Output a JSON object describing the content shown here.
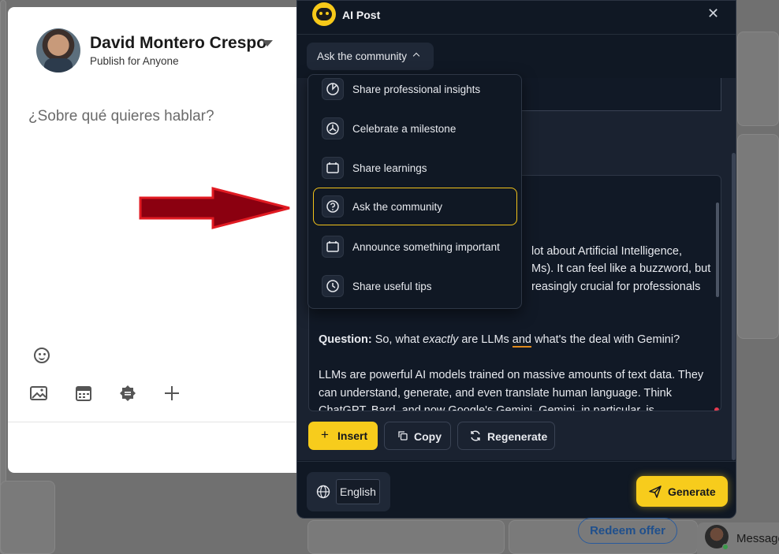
{
  "composer": {
    "user_name": "David Montero Crespo",
    "audience": "Publish for Anyone",
    "placeholder": "¿Sobre qué quieres hablar?"
  },
  "ai_panel": {
    "title": "AI Post",
    "tone_button": "Ask the community",
    "dropdown_items": [
      {
        "label": "Share professional insights",
        "icon": "pie-chart-icon"
      },
      {
        "label": "Celebrate a milestone",
        "icon": "milestone-icon"
      },
      {
        "label": "Share learnings",
        "icon": "learnings-icon"
      },
      {
        "label": "Ask the community",
        "icon": "question-icon",
        "selected": true
      },
      {
        "label": "Announce something important",
        "icon": "calendar-icon"
      },
      {
        "label": "Share useful tips",
        "icon": "clock-icon"
      }
    ],
    "output": {
      "line1_tail": "lot about Artificial Intelligence,",
      "line2_tail": "Ms). It can feel like a buzzword, but",
      "line3_tail": "reasingly crucial for professionals",
      "question_label": "Question:",
      "question_a": " So, what ",
      "question_em": "exactly",
      "question_b": " are LLMs ",
      "question_and": "and",
      "question_c": " what's the deal with Gemini?",
      "para": "LLMs are powerful AI models trained on massive amounts of text data. They can understand, generate, and even translate human language. Think ChatGPT, Bard, and now Google's Gemini. Gemini, in particular, is"
    },
    "buttons": {
      "insert": "Insert",
      "copy": "Copy",
      "regenerate": "Regenerate",
      "generate": "Generate"
    },
    "language": "English",
    "accent_color": "#F7CC1C"
  },
  "background": {
    "redeem": "Redeem offer",
    "messaging": "Message"
  }
}
